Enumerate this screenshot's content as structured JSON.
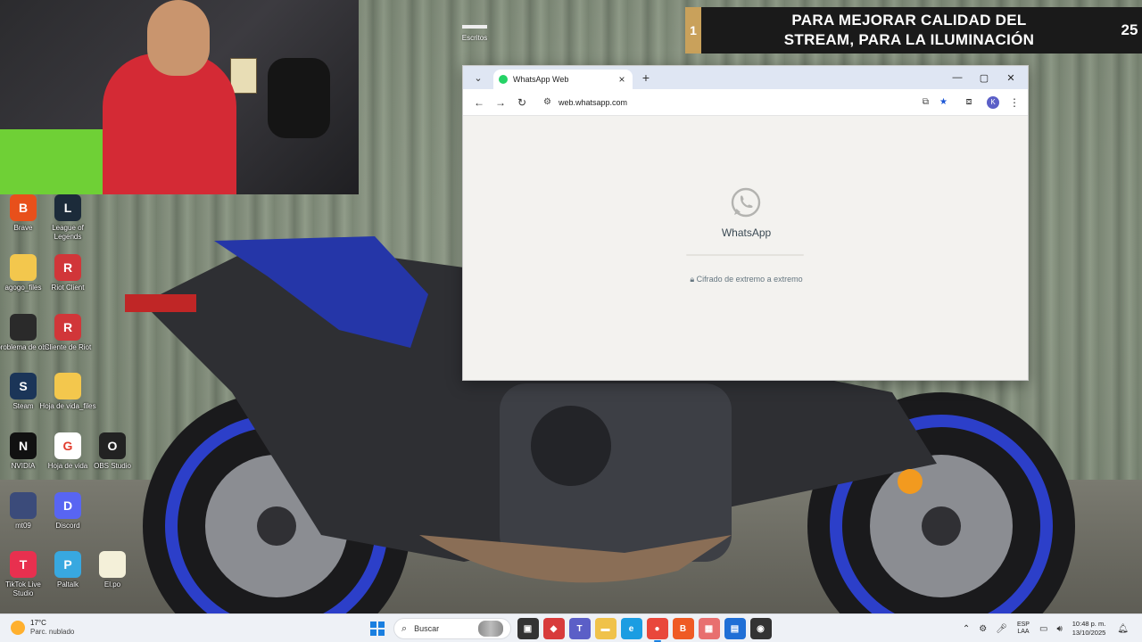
{
  "banner": {
    "left_number": "1",
    "line1": "PARA MEJORAR CALIDAD DEL",
    "line2": "STREAM, PARA LA ILUMINACIÓN",
    "right_number": "25"
  },
  "desktop": {
    "escritos_label": "Escritos",
    "icons": [
      {
        "label": "Brave",
        "color": "#e8501b",
        "glyph": "B"
      },
      {
        "label": "League of Legends",
        "color": "#1c2b3a",
        "glyph": "L"
      },
      {
        "label": "agogo_files",
        "color": "#f3c74d",
        "glyph": ""
      },
      {
        "label": "Riot Client",
        "color": "#d13639",
        "glyph": "R"
      },
      {
        "label": "problema de obs",
        "color": "#2a2a2a",
        "glyph": ""
      },
      {
        "label": "Cliente de Riot",
        "color": "#d13639",
        "glyph": "R"
      },
      {
        "label": "Steam",
        "color": "#1b3558",
        "glyph": "S"
      },
      {
        "label": "Hoja de vida_files",
        "color": "#f3c74d",
        "glyph": ""
      },
      {
        "label": "NVIDIA",
        "color": "#111",
        "glyph": "N"
      },
      {
        "label": "Hoja de vida",
        "color": "#ffffff",
        "glyph": "G"
      },
      {
        "label": "OBS Studio",
        "color": "#222",
        "glyph": "O"
      },
      {
        "label": "mt09",
        "color": "#3b4b7a",
        "glyph": ""
      },
      {
        "label": "Discord",
        "color": "#5865f2",
        "glyph": "D"
      },
      {
        "label": "TikTok Live Studio",
        "color": "#e8304f",
        "glyph": "T"
      },
      {
        "label": "Paltalk",
        "color": "#38a8e0",
        "glyph": "P"
      },
      {
        "label": "El.po",
        "color": "#f4f0d9",
        "glyph": ""
      }
    ]
  },
  "browser": {
    "tab_title": "WhatsApp Web",
    "url": "web.whatsapp.com",
    "profile_initial": "K",
    "page": {
      "app_name": "WhatsApp",
      "encryption_note": "Cifrado de extremo a extremo",
      "progress": 0.0
    }
  },
  "taskbar": {
    "weather_temp": "17°C",
    "weather_desc": "Parc. nublado",
    "search_placeholder": "Buscar",
    "lang_line1": "ESP",
    "lang_line2": "LAA",
    "time": "10:48 p. m.",
    "date": "13/10/2025",
    "apps": [
      {
        "name": "task-view",
        "color": "#333333",
        "glyph": "▣"
      },
      {
        "name": "pdf-app",
        "color": "#d83b3b",
        "glyph": "◆"
      },
      {
        "name": "teams",
        "color": "#5b5fc7",
        "glyph": "T"
      },
      {
        "name": "file-explorer",
        "color": "#f0c24a",
        "glyph": "▬"
      },
      {
        "name": "edge",
        "color": "#1b9de2",
        "glyph": "e"
      },
      {
        "name": "chrome",
        "color": "#e9473b",
        "glyph": "●"
      },
      {
        "name": "brave",
        "color": "#ef5a24",
        "glyph": "B"
      },
      {
        "name": "photos",
        "color": "#e86f6f",
        "glyph": "▦"
      },
      {
        "name": "store",
        "color": "#1f6fd6",
        "glyph": "▤"
      },
      {
        "name": "obs",
        "color": "#333333",
        "glyph": "◉"
      }
    ]
  }
}
